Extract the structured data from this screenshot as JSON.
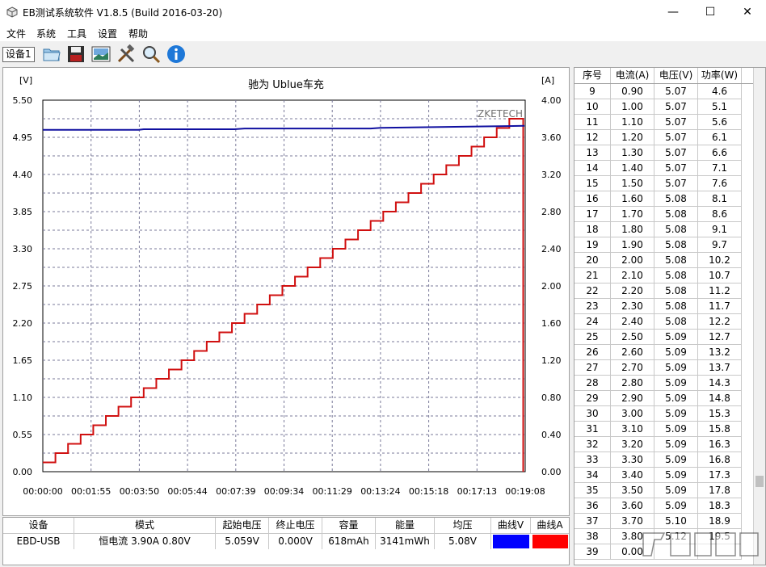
{
  "window": {
    "title": "EB测试系统软件 V1.8.5 (Build 2016-03-20)",
    "controls": {
      "minimize": "—",
      "maximize": "☐",
      "close": "✕"
    }
  },
  "menu": [
    "文件",
    "系统",
    "工具",
    "设置",
    "帮助"
  ],
  "toolbar": {
    "device_tab": "设备1",
    "buttons": [
      "open-folder-icon",
      "save-icon",
      "chart-image-icon",
      "tools-icon",
      "search-icon",
      "info-icon"
    ]
  },
  "colors": {
    "voltage": "#1010a0",
    "current": "#d01010",
    "swatch_v": "#0000ff",
    "swatch_a": "#ff0000"
  },
  "chart_data": {
    "type": "line",
    "title": "驰为 Ublue车充",
    "watermark": "ZKETECH",
    "y_left_label": "[V]",
    "y_right_label": "[A]",
    "y_left_ticks": [
      "5.50",
      "4.95",
      "4.40",
      "3.85",
      "3.30",
      "2.75",
      "2.20",
      "1.65",
      "1.10",
      "0.55",
      "0.00"
    ],
    "y_right_ticks": [
      "4.00",
      "3.60",
      "3.20",
      "2.80",
      "2.40",
      "2.00",
      "1.60",
      "1.20",
      "0.80",
      "0.40",
      "0.00"
    ],
    "x_ticks": [
      "00:00:00",
      "00:01:55",
      "00:03:50",
      "00:05:44",
      "00:07:39",
      "00:09:34",
      "00:11:29",
      "00:13:24",
      "00:15:18",
      "00:17:13",
      "00:19:08"
    ],
    "ylim_left": [
      0,
      5.5
    ],
    "ylim_right": [
      0,
      4.0
    ],
    "x_range_minutes": [
      0,
      19.13
    ],
    "series": [
      {
        "name": "曲线V",
        "axis": "left",
        "x_minutes": [
          0,
          3.8,
          4.0,
          7.6,
          8.0,
          13.0,
          13.4,
          19.1
        ],
        "values": [
          5.06,
          5.06,
          5.07,
          5.07,
          5.08,
          5.08,
          5.09,
          5.12
        ]
      },
      {
        "name": "曲线A",
        "axis": "right",
        "step_minutes": 0.5,
        "step_amps": 0.1,
        "start_amps": 0.1,
        "final_amps": 3.8,
        "end_minutes": 19.05,
        "drop_to": 0.0
      }
    ]
  },
  "table": {
    "headers": [
      "序号",
      "电流(A)",
      "电压(V)",
      "功率(W)"
    ],
    "rows": [
      [
        "9",
        "0.90",
        "5.07",
        "4.6"
      ],
      [
        "10",
        "1.00",
        "5.07",
        "5.1"
      ],
      [
        "11",
        "1.10",
        "5.07",
        "5.6"
      ],
      [
        "12",
        "1.20",
        "5.07",
        "6.1"
      ],
      [
        "13",
        "1.30",
        "5.07",
        "6.6"
      ],
      [
        "14",
        "1.40",
        "5.07",
        "7.1"
      ],
      [
        "15",
        "1.50",
        "5.07",
        "7.6"
      ],
      [
        "16",
        "1.60",
        "5.08",
        "8.1"
      ],
      [
        "17",
        "1.70",
        "5.08",
        "8.6"
      ],
      [
        "18",
        "1.80",
        "5.08",
        "9.1"
      ],
      [
        "19",
        "1.90",
        "5.08",
        "9.7"
      ],
      [
        "20",
        "2.00",
        "5.08",
        "10.2"
      ],
      [
        "21",
        "2.10",
        "5.08",
        "10.7"
      ],
      [
        "22",
        "2.20",
        "5.08",
        "11.2"
      ],
      [
        "23",
        "2.30",
        "5.08",
        "11.7"
      ],
      [
        "24",
        "2.40",
        "5.08",
        "12.2"
      ],
      [
        "25",
        "2.50",
        "5.09",
        "12.7"
      ],
      [
        "26",
        "2.60",
        "5.09",
        "13.2"
      ],
      [
        "27",
        "2.70",
        "5.09",
        "13.7"
      ],
      [
        "28",
        "2.80",
        "5.09",
        "14.3"
      ],
      [
        "29",
        "2.90",
        "5.09",
        "14.8"
      ],
      [
        "30",
        "3.00",
        "5.09",
        "15.3"
      ],
      [
        "31",
        "3.10",
        "5.09",
        "15.8"
      ],
      [
        "32",
        "3.20",
        "5.09",
        "16.3"
      ],
      [
        "33",
        "3.30",
        "5.09",
        "16.8"
      ],
      [
        "34",
        "3.40",
        "5.09",
        "17.3"
      ],
      [
        "35",
        "3.50",
        "5.09",
        "17.8"
      ],
      [
        "36",
        "3.60",
        "5.09",
        "18.3"
      ],
      [
        "37",
        "3.70",
        "5.10",
        "18.9"
      ],
      [
        "38",
        "3.80",
        "5.12",
        "19.5"
      ],
      [
        "39",
        "0.00",
        "",
        ""
      ]
    ]
  },
  "status": {
    "headers": [
      "设备",
      "模式",
      "起始电压",
      "终止电压",
      "容量",
      "能量",
      "均压",
      "曲线V",
      "曲线A"
    ],
    "device": "EBD-USB",
    "mode": "恒电流  3.90A  0.80V",
    "start_voltage": "5.059V",
    "end_voltage": "0.000V",
    "capacity": "618mAh",
    "energy": "3141mWh",
    "avg_voltage": "5.08V"
  }
}
